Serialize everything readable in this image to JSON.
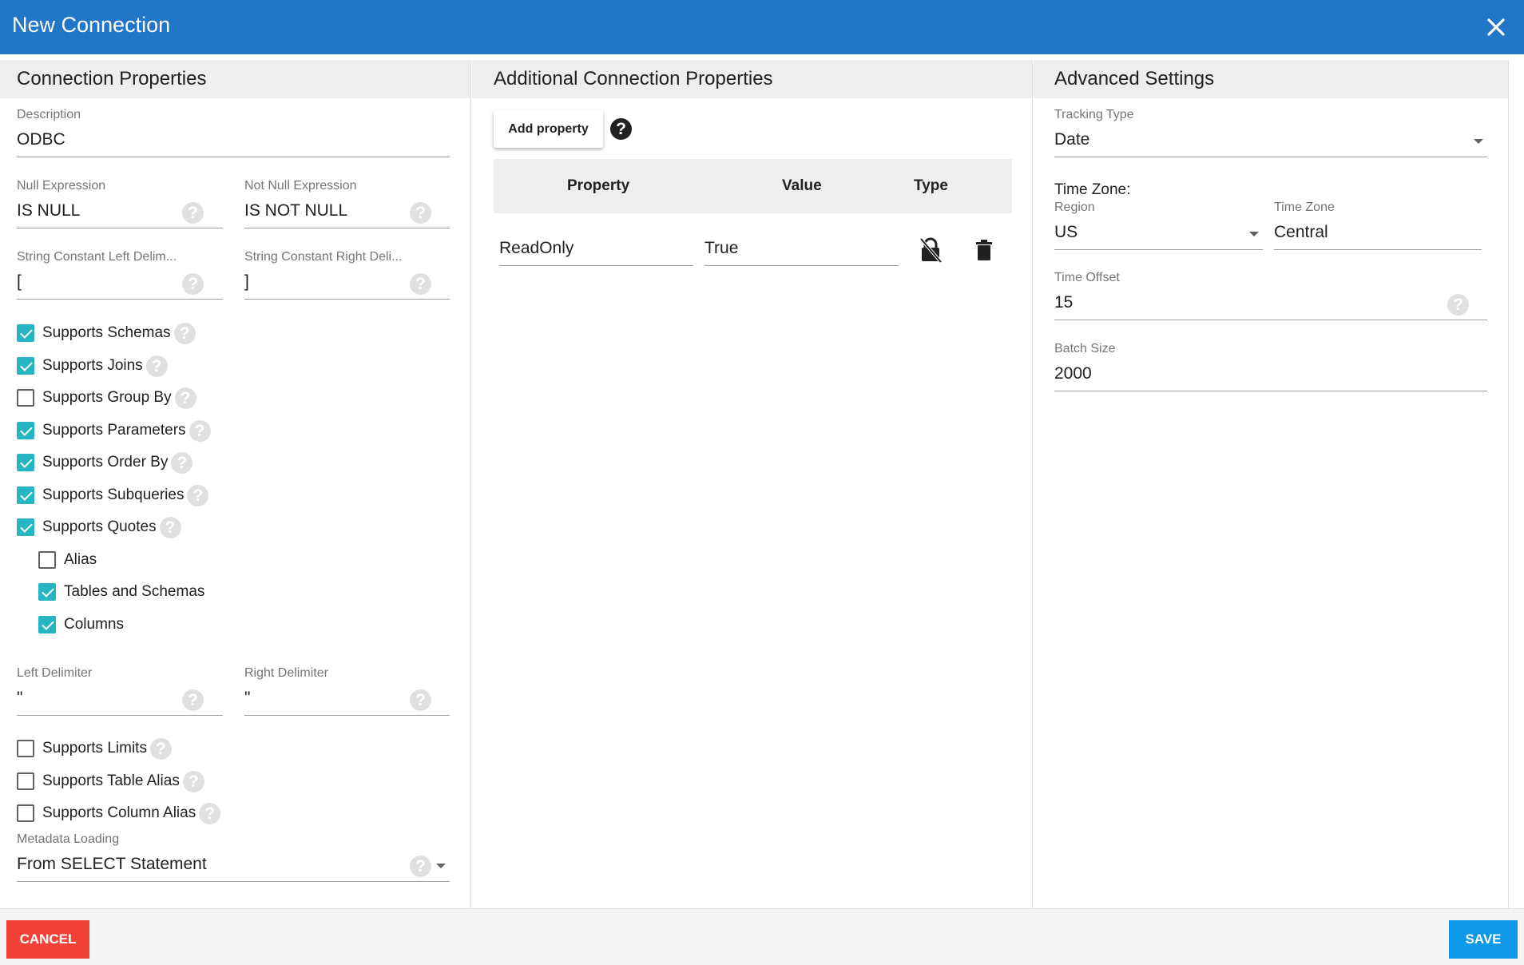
{
  "dialog": {
    "title": "New Connection",
    "close_icon": "close-icon"
  },
  "left": {
    "heading": "Connection Properties",
    "description": {
      "label": "Description",
      "value": "ODBC"
    },
    "null_expression": {
      "label": "Null Expression",
      "value": "IS NULL"
    },
    "not_null_expression": {
      "label": "Not Null Expression",
      "value": "IS NOT NULL"
    },
    "string_left": {
      "label": "String Constant Left Delim...",
      "value": "["
    },
    "string_right": {
      "label": "String Constant Right Deli...",
      "value": "]"
    },
    "checks": [
      {
        "label": "Supports Schemas",
        "checked": true
      },
      {
        "label": "Supports Joins",
        "checked": true
      },
      {
        "label": "Supports Group By",
        "checked": false
      },
      {
        "label": "Supports Parameters",
        "checked": true
      },
      {
        "label": "Supports Order By",
        "checked": true
      },
      {
        "label": "Supports Subqueries",
        "checked": true
      },
      {
        "label": "Supports Quotes",
        "checked": true
      }
    ],
    "quote_checks": [
      {
        "label": "Alias",
        "checked": false
      },
      {
        "label": "Tables and Schemas",
        "checked": true
      },
      {
        "label": "Columns",
        "checked": true
      }
    ],
    "left_delimiter": {
      "label": "Left Delimiter",
      "value": "\""
    },
    "right_delimiter": {
      "label": "Right Delimiter",
      "value": "\""
    },
    "checks2": [
      {
        "label": "Supports Limits",
        "checked": false
      },
      {
        "label": "Supports Table Alias",
        "checked": false
      },
      {
        "label": "Supports Column Alias",
        "checked": false
      }
    ],
    "metadata_loading": {
      "label": "Metadata Loading",
      "value": "From SELECT Statement"
    }
  },
  "middle": {
    "heading": "Additional Connection Properties",
    "add_button": "Add property",
    "columns": {
      "property": "Property",
      "value": "Value",
      "type": "Type"
    },
    "rows": [
      {
        "property": "ReadOnly",
        "value": "True",
        "type_icon": "lock-off-icon",
        "delete_icon": "trash-icon"
      }
    ]
  },
  "right": {
    "heading": "Advanced Settings",
    "tracking_type": {
      "label": "Tracking Type",
      "value": "Date"
    },
    "time_zone_heading": "Time Zone:",
    "region": {
      "label": "Region",
      "value": "US"
    },
    "time_zone": {
      "label": "Time Zone",
      "value": "Central"
    },
    "time_offset": {
      "label": "Time Offset",
      "value": "15"
    },
    "batch_size": {
      "label": "Batch Size",
      "value": "2000"
    }
  },
  "footer": {
    "cancel": "CANCEL",
    "save": "SAVE"
  },
  "colors": {
    "header": "#2176c7",
    "checkbox": "#26b5c2",
    "cancel": "#f44336",
    "save": "#0d99e8"
  }
}
